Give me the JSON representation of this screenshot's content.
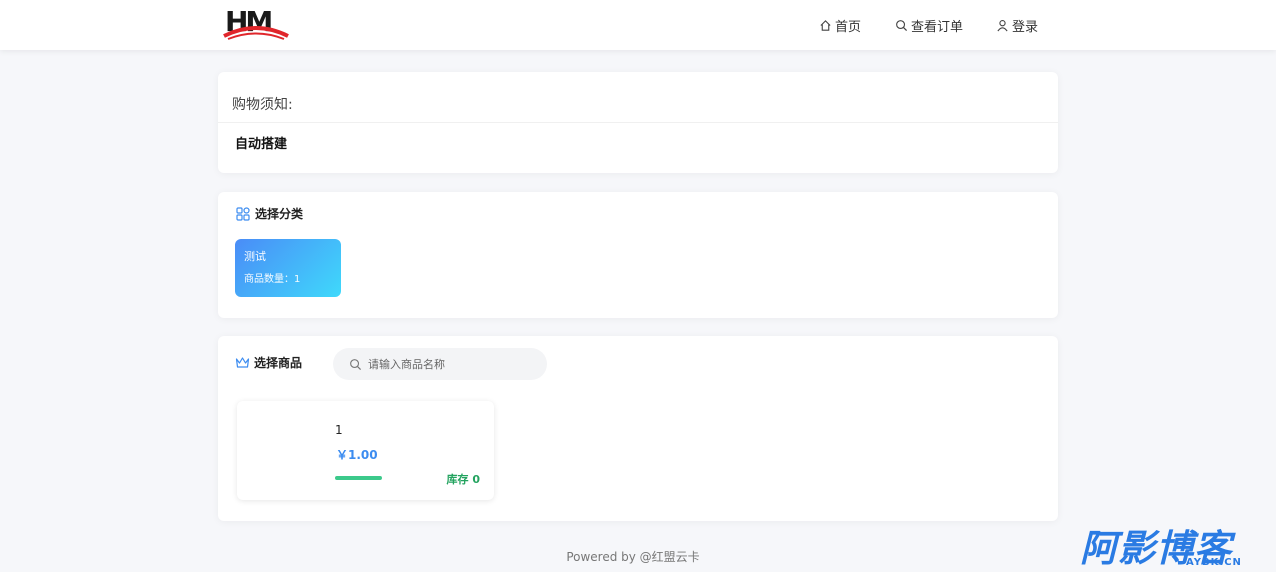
{
  "header": {
    "logo_text": "HM",
    "nav": [
      {
        "label": "首页",
        "icon": "home-icon"
      },
      {
        "label": "查看订单",
        "icon": "search-icon"
      },
      {
        "label": "登录",
        "icon": "user-icon"
      }
    ]
  },
  "notice": {
    "title": "购物须知:",
    "body": "自动搭建"
  },
  "category_section": {
    "title": "选择分类",
    "icon": "grid-icon",
    "categories": [
      {
        "name": "测试",
        "count_label": "商品数量：1"
      }
    ]
  },
  "product_section": {
    "title": "选择商品",
    "icon": "crown-icon",
    "search_placeholder": "请输入商品名称",
    "products": [
      {
        "name": "1",
        "price": "￥1.00",
        "stock_label": "库存 0"
      }
    ]
  },
  "footer": {
    "text": "Powered by @红盟云卡"
  },
  "watermark": {
    "text": "阿影博客",
    "sub": "AYBK.CN"
  },
  "colors": {
    "accent": "#3c8cf0",
    "stock": "#23a35f",
    "logo_red": "#e0262b"
  }
}
